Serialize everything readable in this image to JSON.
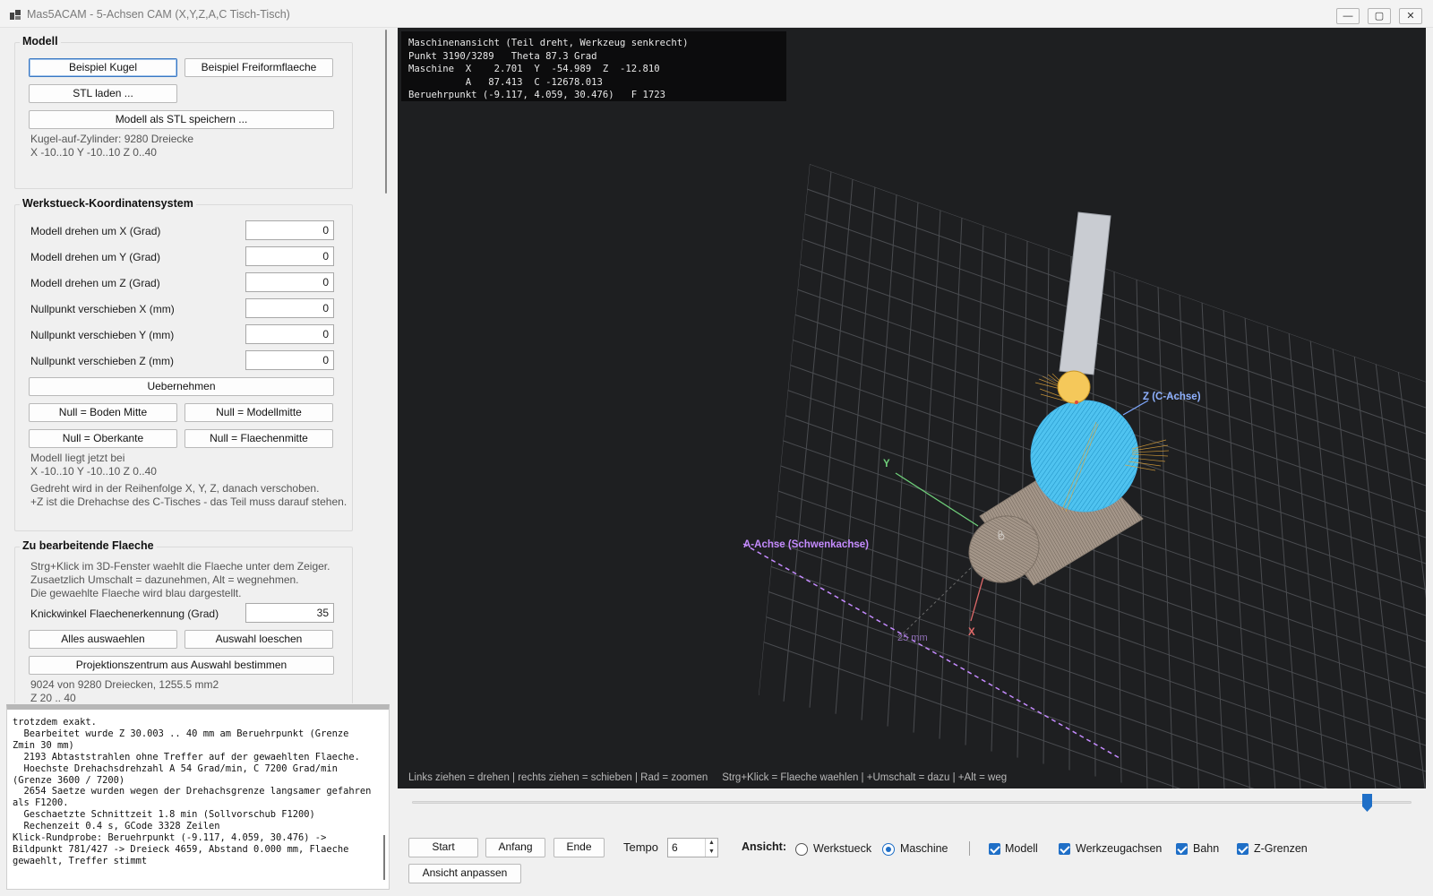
{
  "window": {
    "title": "Mas5ACAM - 5-Achsen CAM (X,Y,Z,A,C Tisch-Tisch)",
    "min": "―",
    "max": "▢",
    "close": "✕"
  },
  "modell": {
    "title": "Modell",
    "btn_kugel": "Beispiel Kugel",
    "btn_freiform": "Beispiel Freiformflaeche",
    "btn_stl": "STL laden ...",
    "btn_save": "Modell als STL speichern ...",
    "info1": "Kugel-auf-Zylinder: 9280 Dreiecke",
    "info2": "X -10..10  Y -10..10  Z 0..40"
  },
  "wks": {
    "title": "Werkstueck-Koordinatensystem",
    "rows": [
      {
        "label": "Modell drehen um X (Grad)",
        "value": "0"
      },
      {
        "label": "Modell drehen um Y (Grad)",
        "value": "0"
      },
      {
        "label": "Modell drehen um Z (Grad)",
        "value": "0"
      },
      {
        "label": "Nullpunkt verschieben X (mm)",
        "value": "0"
      },
      {
        "label": "Nullpunkt verschieben Y (mm)",
        "value": "0"
      },
      {
        "label": "Nullpunkt verschieben Z (mm)",
        "value": "0"
      }
    ],
    "btn_apply": "Uebernehmen",
    "btn_boden": "Null = Boden Mitte",
    "btn_modellmitte": "Null = Modellmitte",
    "btn_oberkante": "Null = Oberkante",
    "btn_flaechenmitte": "Null = Flaechenmitte",
    "info1": "Modell liegt jetzt bei",
    "info2": "X -10..10   Y -10..10   Z 0..40",
    "info3": "Gedreht wird in der Reihenfolge X, Y, Z, danach verschoben.",
    "info4": "+Z ist die Drehachse des C-Tisches - das Teil muss darauf stehen."
  },
  "flaeche": {
    "title": "Zu bearbeitende Flaeche",
    "hint1": "Strg+Klick im 3D-Fenster waehlt die Flaeche unter dem Zeiger.",
    "hint2": "Zusaetzlich Umschalt = dazunehmen, Alt = wegnehmen.",
    "hint3": "Die gewaehlte Flaeche wird blau dargestellt.",
    "knick_label": "Knickwinkel Flaechenerkennung (Grad)",
    "knick_value": "35",
    "btn_all": "Alles auswaehlen",
    "btn_clear": "Auswahl loeschen",
    "btn_proj": "Projektionszentrum aus Auswahl bestimmen",
    "info1": "9024 von 9280 Dreiecken, 1255.5 mm2",
    "info2": "Z 20 .. 40"
  },
  "log": "trotzdem exakt.\n  Bearbeitet wurde Z 30.003 .. 40 mm am Beruehrpunkt (Grenze Zmin 30 mm)\n  2193 Abtaststrahlen ohne Treffer auf der gewaehlten Flaeche.\n  Hoechste Drehachsdrehzahl A 54 Grad/min, C 7200 Grad/min (Grenze 3600 / 7200)\n  2654 Saetze wurden wegen der Drehachsgrenze langsamer gefahren als F1200.\n  Geschaetzte Schnittzeit 1.8 min (Sollvorschub F1200)\n  Rechenzeit 0.4 s, GCode 3328 Zeilen\nKlick-Rundprobe: Beruehrpunkt (-9.117, 4.059, 30.476) -> Bildpunkt 781/427 -> Dreieck 4659, Abstand 0.000 mm, Flaeche gewaehlt, Treffer stimmt",
  "viewport": {
    "overlay": "Maschinenansicht (Teil dreht, Werkzeug senkrecht)\nPunkt 3190/3289   Theta 87.3 Grad\nMaschine  X    2.701  Y  -54.989  Z  -12.810\n          A   87.413  C -12678.013\nBeruehrpunkt (-9.117, 4.059, 30.476)   F 1723",
    "label_z": "Z (C-Achse)",
    "label_y": "Y",
    "label_x": "X",
    "label_a": "A-Achse (Schwenkachse)",
    "label_25": "25 mm",
    "label_0": "0",
    "hint": "Links ziehen = drehen | rechts ziehen = schieben | Rad = zoomen     Strg+Klick = Flaeche waehlen | +Umschalt = dazu | +Alt = weg"
  },
  "controls": {
    "slider_pos": 0.955,
    "btn_start": "Start",
    "btn_anfang": "Anfang",
    "btn_ende": "Ende",
    "tempo_label": "Tempo",
    "tempo_value": "6",
    "ansicht_label": "Ansicht:",
    "radio_werkstueck": "Werkstueck",
    "radio_maschine": "Maschine",
    "cb_modell": "Modell",
    "cb_werkzeugachsen": "Werkzeugachsen",
    "cb_bahn": "Bahn",
    "cb_zgrenzen": "Z-Grenzen",
    "btn_fit": "Ansicht anpassen"
  },
  "colors": {
    "selection": "#4fc3f0",
    "tool": "#c9ccd2",
    "ball": "#f5c85a",
    "cylinder": "#9b8f84",
    "a_axis": "#c58bff",
    "accent": "#1f6fc7"
  }
}
